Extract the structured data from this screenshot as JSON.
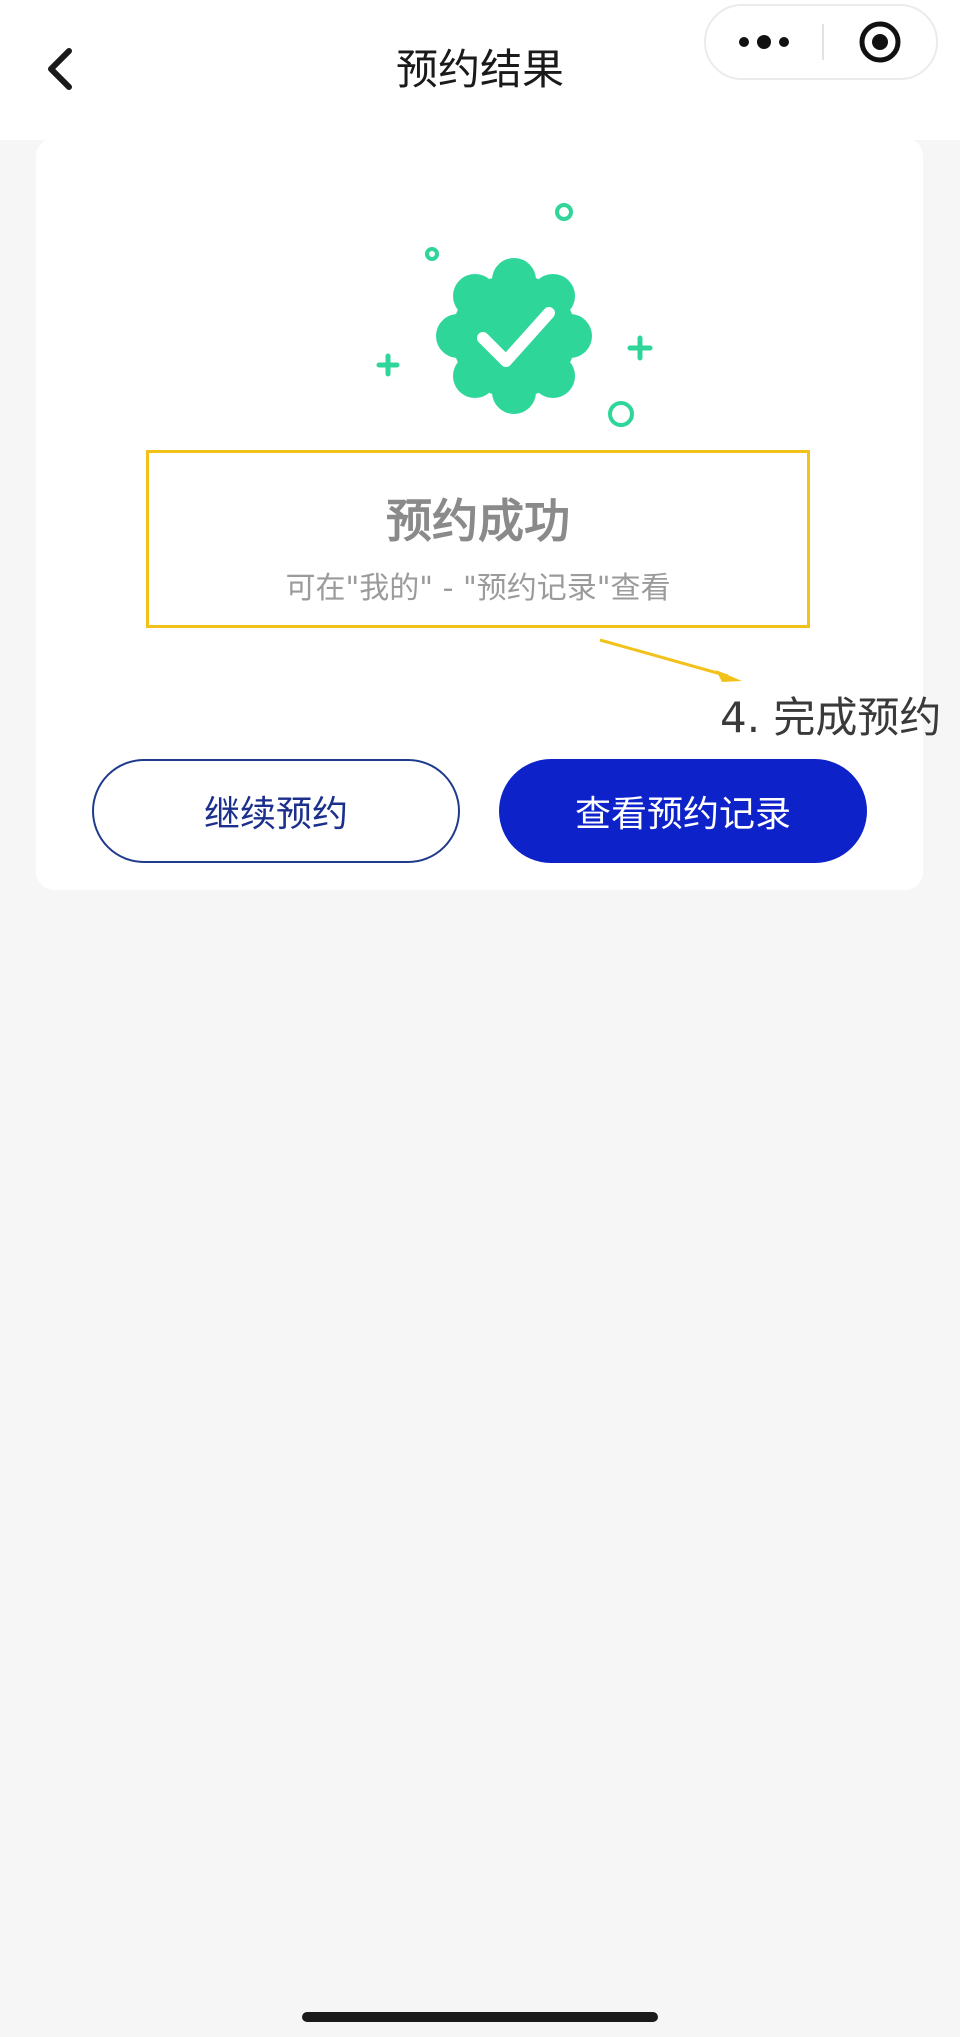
{
  "header": {
    "title": "预约结果"
  },
  "icons": {
    "back": "chevron-left-icon",
    "more": "more-dots-icon",
    "close": "target-circle-icon",
    "success": "check-badge-icon"
  },
  "result": {
    "title": "预约成功",
    "subtitle": "可在\"我的\" - \"预约记录\"查看"
  },
  "annotation": {
    "step_label": "4. 完成预约"
  },
  "actions": {
    "continue_label": "继续预约",
    "view_records_label": "查看预约记录"
  },
  "colors": {
    "success_green": "#2fd69a",
    "primary_blue": "#0d22c9",
    "highlight_yellow": "#f2c21a"
  }
}
